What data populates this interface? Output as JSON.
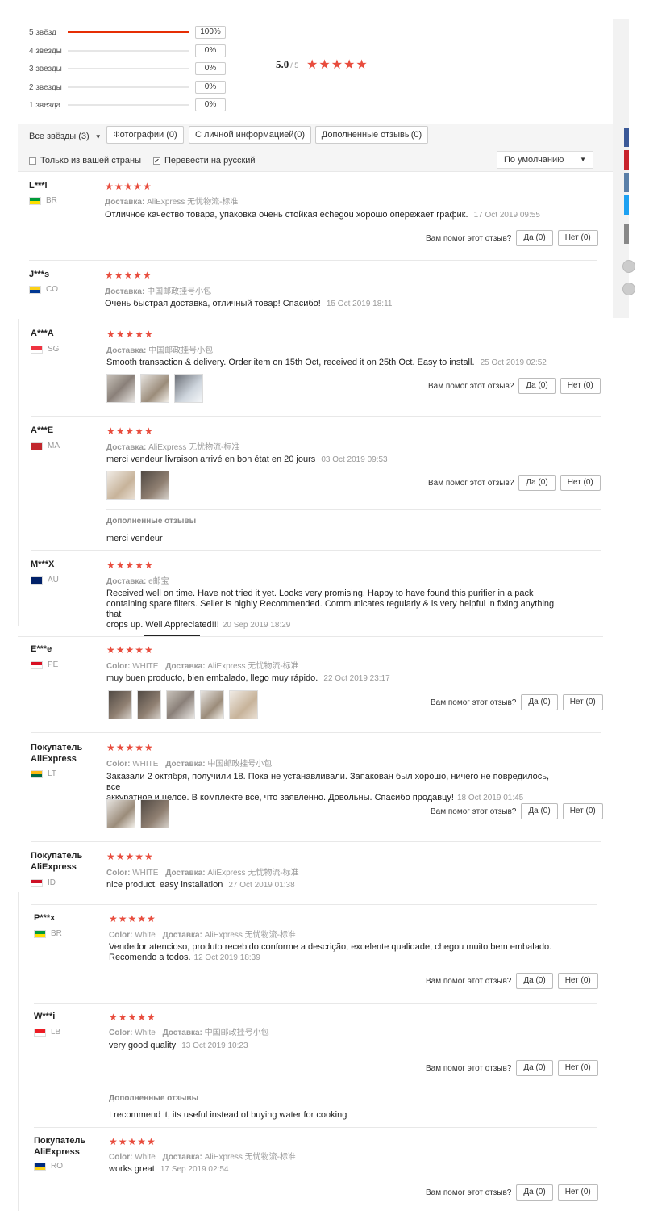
{
  "histogram": [
    {
      "label": "5 звёзд",
      "pct": "100%",
      "fill": 1.0
    },
    {
      "label": "4 звезды",
      "pct": "0%",
      "fill": 0
    },
    {
      "label": "3 звезды",
      "pct": "0%",
      "fill": 0
    },
    {
      "label": "2 звезды",
      "pct": "0%",
      "fill": 0
    },
    {
      "label": "1 звезда",
      "pct": "0%",
      "fill": 0
    }
  ],
  "rating": {
    "avg": "5.0",
    "max": "/ 5",
    "stars": "★★★★★"
  },
  "filters": {
    "all": "Все звёзды (3)",
    "photos": "Фотографии (0)",
    "personal": "С личной информацией(0)",
    "additional": "Дополненные отзывы(0)",
    "own_country": "Только из вашей страны",
    "translate": "Перевести на русский",
    "sort": "По умолчанию"
  },
  "helpful_label": "Вам помог этот отзыв?",
  "yes_label": "Да (0)",
  "no_label": "Нет (0)",
  "additional_title": "Дополненные отзывы",
  "stars": "★★★★★",
  "reviews": [
    {
      "user": "L***l",
      "country": "BR",
      "flag_colors": [
        "#009b3a",
        "#fedf00"
      ],
      "color": "",
      "shipping_label": "Доставка:",
      "shipping": "AliExpress 无忧物流-标准",
      "text": "Отличное качество товара, упаковка очень стойкая echegou хорошо опережает график.",
      "date": "17 Oct 2019 09:55"
    },
    {
      "user": "J***s",
      "country": "CO",
      "flag_colors": [
        "#fcd116",
        "#003893"
      ],
      "color": "",
      "shipping_label": "Доставка:",
      "shipping": "中国邮政挂号小包",
      "text": "Очень быстрая доставка, отличный товар! Спасибо!",
      "date": "15 Oct 2019 18:11"
    },
    {
      "user": "A***A",
      "country": "SG",
      "flag_colors": [
        "#ef3340",
        "#ffffff"
      ],
      "color": "",
      "shipping_label": "Доставка:",
      "shipping": "中国邮政挂号小包",
      "text": "Smooth transaction & delivery. Order item on 15th Oct, received it on 25th Oct. Easy to install.",
      "date": "25 Oct 2019 02:52"
    },
    {
      "user": "A***E",
      "country": "MA",
      "flag_colors": [
        "#c1272d",
        "#c1272d"
      ],
      "color": "",
      "shipping_label": "Доставка:",
      "shipping": "AliExpress 无忧物流-标准",
      "text": "merci vendeur livraison arrivé en bon état en 20 jours",
      "date": "03 Oct 2019 09:53",
      "additional": "merci vendeur"
    },
    {
      "user": "M***X",
      "country": "AU",
      "flag_colors": [
        "#012169",
        "#012169"
      ],
      "color": "",
      "shipping_label": "Доставка:",
      "shipping": "e邮宝",
      "text1": "Received well on time. Have not tried it yet. Looks very promising. Happy to have found this purifier in a pack",
      "text2": "containing spare filters. Seller is highly Recommended. Communicates regularly & is very helpful in fixing anything that",
      "text3": "crops up. Well Appreciated!!!",
      "date": "20 Sep 2019 18:29"
    },
    {
      "user": "E***e",
      "country": "PE",
      "flag_colors": [
        "#d91023",
        "#ffffff"
      ],
      "color_label": "Color:",
      "color": "WHITE",
      "shipping_label": "Доставка:",
      "shipping": "AliExpress 无忧物流-标准",
      "text": "muy buen producto, bien embalado, llego muy rápido.",
      "date": "22 Oct 2019 23:17"
    },
    {
      "user1": "Покупатель",
      "user2": "AliExpress",
      "country": "LT",
      "flag_colors": [
        "#fdb913",
        "#006a44"
      ],
      "color_label": "Color:",
      "color": "WHITE",
      "shipping_label": "Доставка:",
      "shipping": "中国邮政挂号小包",
      "text1": "Заказали 2 октября, получили 18. Пока не устанавливали. Запакован был хорошо, ничего не повредилось, все",
      "text2": "аккуратное и целое. В комплекте все, что заявленно. Довольны. Спасибо продавцу!",
      "date": "18 Oct 2019 01:45"
    },
    {
      "user1": "Покупатель",
      "user2": "AliExpress",
      "country": "ID",
      "flag_colors": [
        "#ce1126",
        "#ffffff"
      ],
      "color_label": "Color:",
      "color": "WHITE",
      "shipping_label": "Доставка:",
      "shipping": "AliExpress 无忧物流-标准",
      "text": "nice product. easy installation",
      "date": "27 Oct 2019 01:38"
    },
    {
      "user": "P***x",
      "country": "BR",
      "flag_colors": [
        "#009b3a",
        "#fedf00"
      ],
      "color_label": "Color:",
      "color": "White",
      "shipping_label": "Доставка:",
      "shipping": "AliExpress 无忧物流-标准",
      "text1": "Vendedor atencioso, produto recebido conforme a descrição, excelente qualidade, chegou muito bem embalado.",
      "text2": "Recomendo a todos.",
      "date": "12 Oct 2019 18:39"
    },
    {
      "user": "W***i",
      "country": "LB",
      "flag_colors": [
        "#ed1c24",
        "#ffffff"
      ],
      "color_label": "Color:",
      "color": "White",
      "shipping_label": "Доставка:",
      "shipping": "中国邮政挂号小包",
      "text": "very good quality",
      "date": "13 Oct 2019 10:23",
      "additional": "I recommend it, its useful instead of buying water for cooking"
    },
    {
      "user1": "Покупатель",
      "user2": "AliExpress",
      "country": "RO",
      "flag_colors": [
        "#002b7f",
        "#fcd116"
      ],
      "color_label": "Color:",
      "color": "White",
      "shipping_label": "Доставка:",
      "shipping": "AliExpress 无忧物流-标准",
      "text": "works great",
      "date": "17 Sep 2019 02:54"
    }
  ]
}
